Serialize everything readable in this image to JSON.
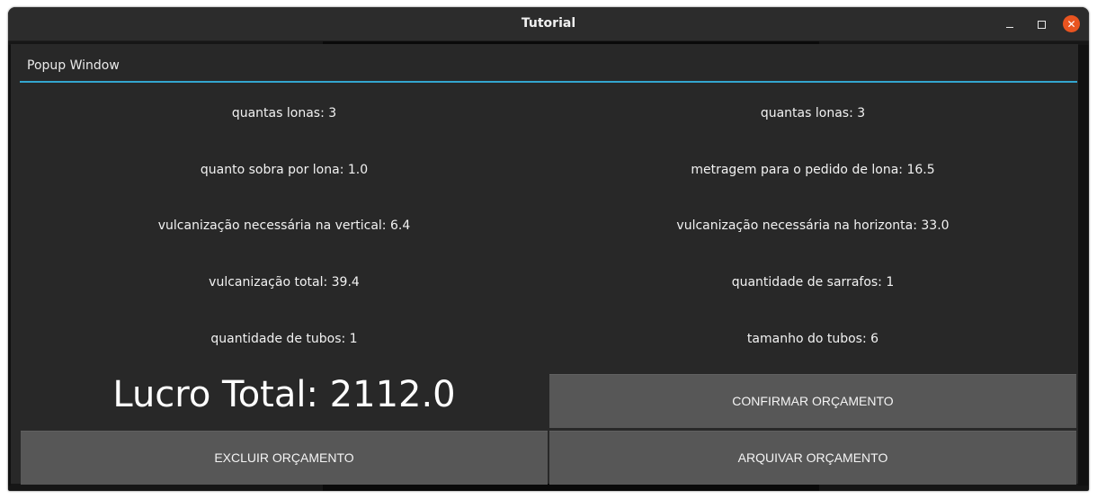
{
  "window": {
    "title": "Tutorial",
    "minimize_icon": "minimize-icon",
    "maximize_icon": "maximize-icon",
    "close_icon": "close-icon",
    "close_color": "#e95420"
  },
  "popup": {
    "title": "Popup Window",
    "accent_color": "#33a6cf"
  },
  "rows": [
    {
      "left": "quantas lonas: 3",
      "right": "quantas lonas: 3"
    },
    {
      "left": "quanto sobra por lona: 1.0",
      "right": "metragem para o pedido de lona: 16.5"
    },
    {
      "left": "vulcanização necessária na vertical: 6.4",
      "right": "vulcanização necessária na horizonta: 33.0"
    },
    {
      "left": "vulcanização total: 39.4",
      "right": "quantidade de sarrafos: 1"
    },
    {
      "left": "quantidade de tubos: 1",
      "right": "tamanho do tubos: 6"
    }
  ],
  "lucro_total": "Lucro Total: 2112.0",
  "buttons": {
    "confirmar": "CONFIRMAR ORÇAMENTO",
    "excluir": "EXCLUIR ORÇAMENTO",
    "arquivar": "ARQUIVAR ORÇAMENTO"
  }
}
